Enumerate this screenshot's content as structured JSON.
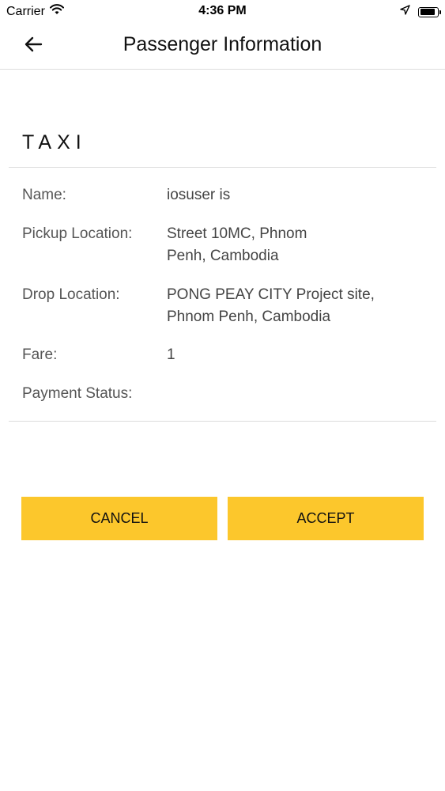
{
  "status_bar": {
    "carrier": "Carrier",
    "time": "4:36 PM",
    "battery_level": 0.9
  },
  "nav": {
    "title": "Passenger Information"
  },
  "section": {
    "title": "TAXI"
  },
  "details": {
    "name_label": "Name:",
    "name_value": "iosuser is",
    "pickup_label": "Pickup Location:",
    "pickup_value_line1": "Street 10MC, Phnom",
    "pickup_value_line2": "Penh, Cambodia",
    "drop_label": "Drop Location:",
    "drop_value_line1": "PONG PEAY CITY Project site,",
    "drop_value_line2": "Phnom Penh, Cambodia",
    "fare_label": "Fare:",
    "fare_value": "1",
    "payment_label": "Payment Status:",
    "payment_value": ""
  },
  "actions": {
    "cancel_label": "CANCEL",
    "accept_label": "ACCEPT"
  },
  "colors": {
    "accent": "#fcc72c",
    "divider": "#dcdcdc"
  }
}
